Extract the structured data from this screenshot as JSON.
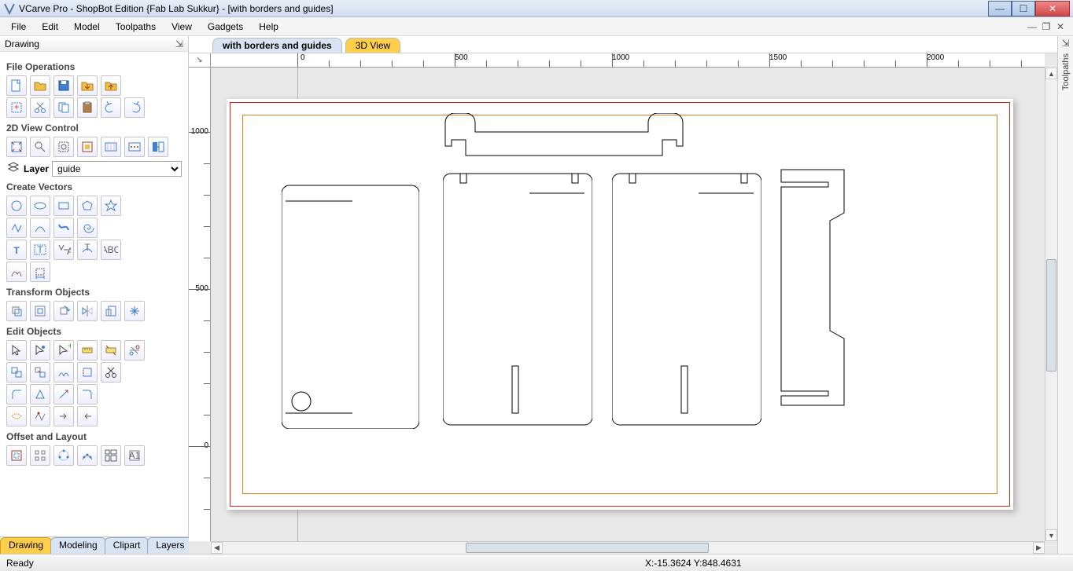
{
  "window": {
    "title": "VCarve Pro - ShopBot Edition {Fab Lab Sukkur} - [with borders and guides]"
  },
  "menus": [
    "File",
    "Edit",
    "Model",
    "Toolpaths",
    "View",
    "Gadgets",
    "Help"
  ],
  "panel": {
    "title": "Drawing",
    "sections": {
      "file_ops": "File Operations",
      "view_ctrl": "2D View Control",
      "layer_lbl": "Layer",
      "layer_val": "guide",
      "create": "Create Vectors",
      "transform": "Transform Objects",
      "edit": "Edit Objects",
      "offset": "Offset and Layout"
    }
  },
  "bottom_tabs": [
    "Drawing",
    "Modeling",
    "Clipart",
    "Layers"
  ],
  "doc_tabs": [
    "with borders and guides",
    "3D View"
  ],
  "ruler_x_ticks": [
    "0",
    "500",
    "1000",
    "1500",
    "2000"
  ],
  "ruler_y_ticks": [
    "0",
    "500",
    "1000"
  ],
  "right_panel": "Toolpaths",
  "status": {
    "ready": "Ready",
    "coord": "X:-15.3624 Y:848.4631"
  },
  "icons": {
    "min": "—",
    "max": "☐",
    "close": "✕",
    "pin": "⇲",
    "docmin": "—",
    "docrestore": "❐",
    "docclose": "✕",
    "corner": "↘",
    "left": "◀",
    "right": "▶",
    "up": "▲",
    "down": "▼"
  }
}
